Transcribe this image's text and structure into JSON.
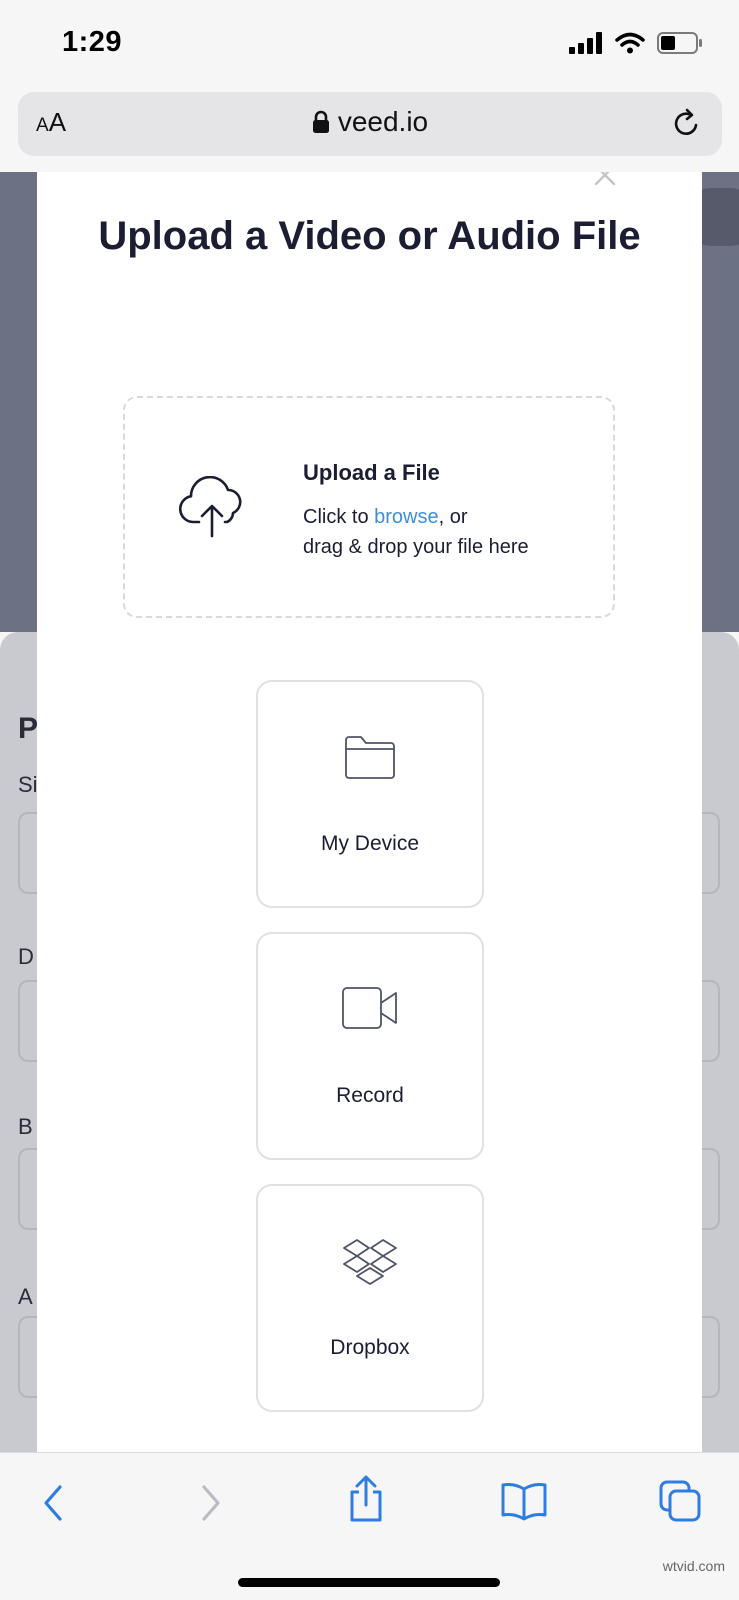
{
  "status_bar": {
    "time": "1:29"
  },
  "address_bar": {
    "aa_label_small": "A",
    "aa_label_large": "A",
    "url": "veed.io"
  },
  "modal": {
    "title": "Upload a Video or Audio File",
    "dropzone": {
      "title": "Upload a File",
      "line1_prefix": "Click to ",
      "browse_link": "browse",
      "line1_suffix": ", or",
      "line2": "drag & drop your file here"
    },
    "sources": [
      {
        "label": "My Device",
        "icon": "folder-icon"
      },
      {
        "label": "Record",
        "icon": "video-camera-icon"
      },
      {
        "label": "Dropbox",
        "icon": "dropbox-icon"
      }
    ]
  },
  "background_page": {
    "heading_letter": "P",
    "field_letters": [
      "Si",
      "D",
      "B",
      "A"
    ]
  },
  "toolbar": {
    "icons": [
      "back-icon",
      "forward-icon",
      "share-icon",
      "bookmarks-icon",
      "tabs-icon"
    ]
  },
  "watermark": "wtvid.com",
  "colors": {
    "accent": "#3c8fd8",
    "text": "#1b1e33",
    "toolbar_blue": "#2f7de1"
  }
}
